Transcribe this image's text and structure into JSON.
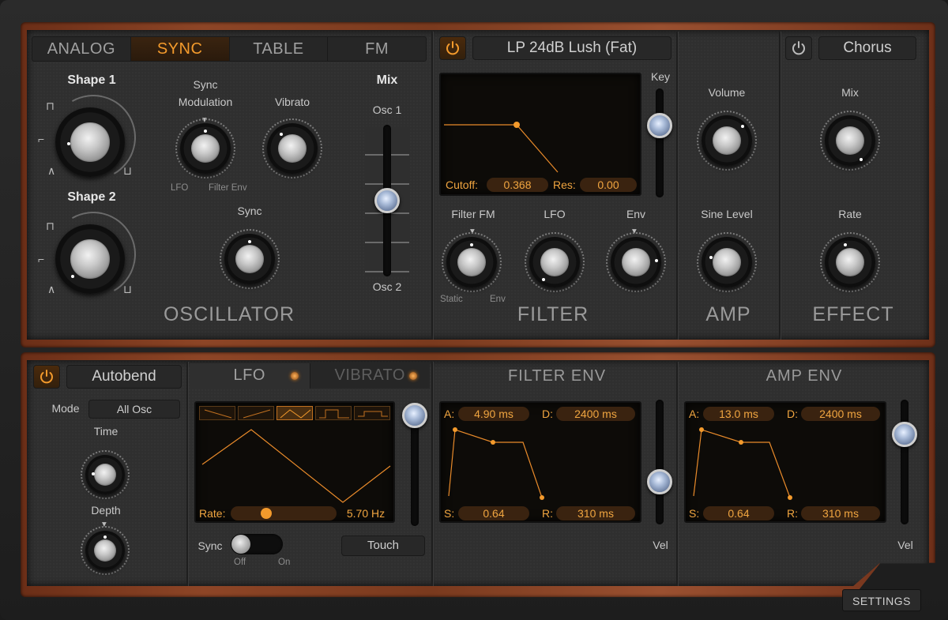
{
  "oscillator": {
    "tabs": [
      "ANALOG",
      "SYNC",
      "TABLE",
      "FM"
    ],
    "active_tab": "SYNC",
    "shape1_label": "Shape 1",
    "shape2_label": "Shape 2",
    "sync_mod_label_1": "Sync",
    "sync_mod_label_2": "Modulation",
    "sync_mod_left": "LFO",
    "sync_mod_right": "Filter Env",
    "vibrato_label": "Vibrato",
    "sync_label": "Sync",
    "mix_label": "Mix",
    "osc1_label": "Osc 1",
    "osc2_label": "Osc 2",
    "title": "OSCILLATOR"
  },
  "filter": {
    "type": "LP 24dB Lush (Fat)",
    "key_label": "Key",
    "cutoff_label": "Cutoff:",
    "cutoff_value": "0.368",
    "res_label": "Res:",
    "res_value": "0.00",
    "filter_fm_label": "Filter FM",
    "fm_left": "Static",
    "fm_right": "Env",
    "lfo_label": "LFO",
    "env_label": "Env",
    "title": "FILTER"
  },
  "amp": {
    "volume_label": "Volume",
    "sine_level_label": "Sine Level",
    "title": "AMP"
  },
  "effect": {
    "type": "Chorus",
    "mix_label": "Mix",
    "rate_label": "Rate",
    "title": "EFFECT"
  },
  "autobend": {
    "title": "Autobend",
    "mode_label": "Mode",
    "mode_value": "All Osc",
    "time_label": "Time",
    "depth_label": "Depth"
  },
  "lfo": {
    "tabs": [
      "LFO",
      "VIBRATO"
    ],
    "rate_label": "Rate:",
    "rate_value": "5.70 Hz",
    "rate_fraction": 0.32,
    "sync_label": "Sync",
    "sync_off": "Off",
    "sync_on": "On",
    "touch_label": "Touch",
    "waveforms": [
      "ramp-down",
      "ramp-up",
      "triangle",
      "square",
      "pulse"
    ],
    "active_waveform": "triangle"
  },
  "filter_env": {
    "title": "FILTER ENV",
    "a_label": "A:",
    "a_value": "4.90 ms",
    "d_label": "D:",
    "d_value": "2400 ms",
    "s_label": "S:",
    "s_value": "0.64",
    "r_label": "R:",
    "r_value": "310 ms",
    "vel_label": "Vel"
  },
  "amp_env": {
    "title": "AMP ENV",
    "a_label": "A:",
    "a_value": "13.0 ms",
    "d_label": "D:",
    "d_value": "2400 ms",
    "s_label": "S:",
    "s_value": "0.64",
    "r_label": "R:",
    "r_value": "310 ms",
    "vel_label": "Vel"
  },
  "settings_label": "SETTINGS",
  "colors": {
    "accent": "#f39a2c",
    "wood": "#8d4526",
    "panel": "#2f2f2f"
  }
}
